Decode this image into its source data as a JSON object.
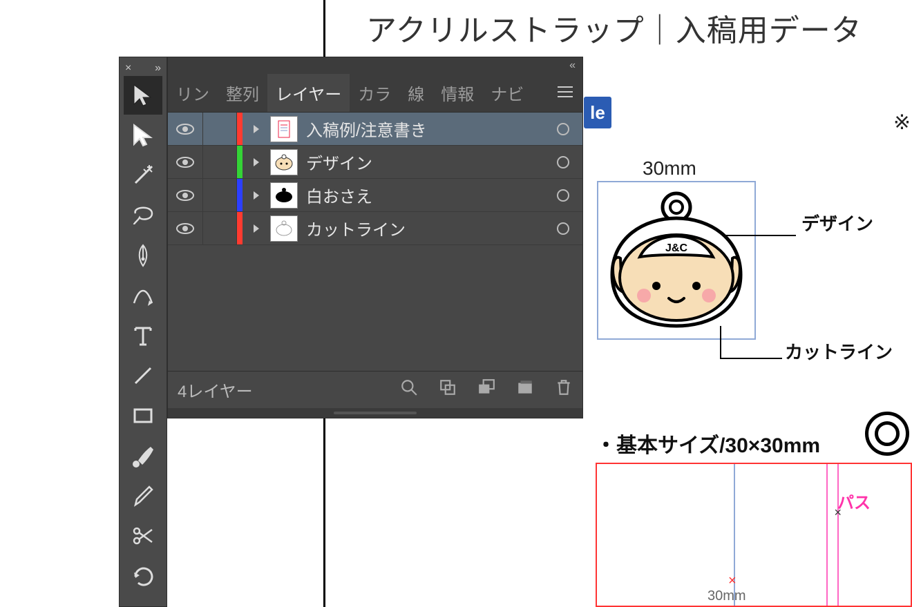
{
  "document": {
    "title": "アクリルストラップ｜入稿用データ",
    "note_glyph": "※",
    "blue_tag": "le",
    "dim_label": "30mm",
    "label_design": "デザイン",
    "label_cutline": "カットライン",
    "size_note": "・基本サイズ/30×30mm",
    "path_label": "パス",
    "mini_dim": "30mm",
    "red_x": "×",
    "anchor_glyph": "×",
    "char_text": "J&C"
  },
  "panel": {
    "close": "×",
    "expand": "»",
    "collapse": "«",
    "tabs": {
      "link": "リン",
      "align": "整列",
      "layers": "レイヤー",
      "color": "カラ",
      "stroke": "線",
      "info": "情報",
      "nav": "ナビ"
    },
    "layers": [
      {
        "name": "入稿例/注意書き",
        "color": "#ff3b30",
        "selected": true,
        "thumb": "doc"
      },
      {
        "name": "デザイン",
        "color": "#34d336",
        "selected": false,
        "thumb": "face"
      },
      {
        "name": "白おさえ",
        "color": "#2c3fff",
        "selected": false,
        "thumb": "blob"
      },
      {
        "name": "カットライン",
        "color": "#ff3b30",
        "selected": false,
        "thumb": "outline"
      }
    ],
    "footer_count": "4レイヤー"
  },
  "tools": [
    {
      "id": "selection",
      "selected": true
    },
    {
      "id": "direct-select",
      "selected": false
    },
    {
      "id": "magic-wand",
      "selected": false
    },
    {
      "id": "lasso",
      "selected": false
    },
    {
      "id": "pen",
      "selected": false
    },
    {
      "id": "curvature",
      "selected": false
    },
    {
      "id": "type",
      "selected": false
    },
    {
      "id": "line",
      "selected": false
    },
    {
      "id": "rectangle",
      "selected": false
    },
    {
      "id": "paintbrush",
      "selected": false
    },
    {
      "id": "pencil",
      "selected": false
    },
    {
      "id": "scissors",
      "selected": false
    },
    {
      "id": "rotate",
      "selected": false
    }
  ]
}
